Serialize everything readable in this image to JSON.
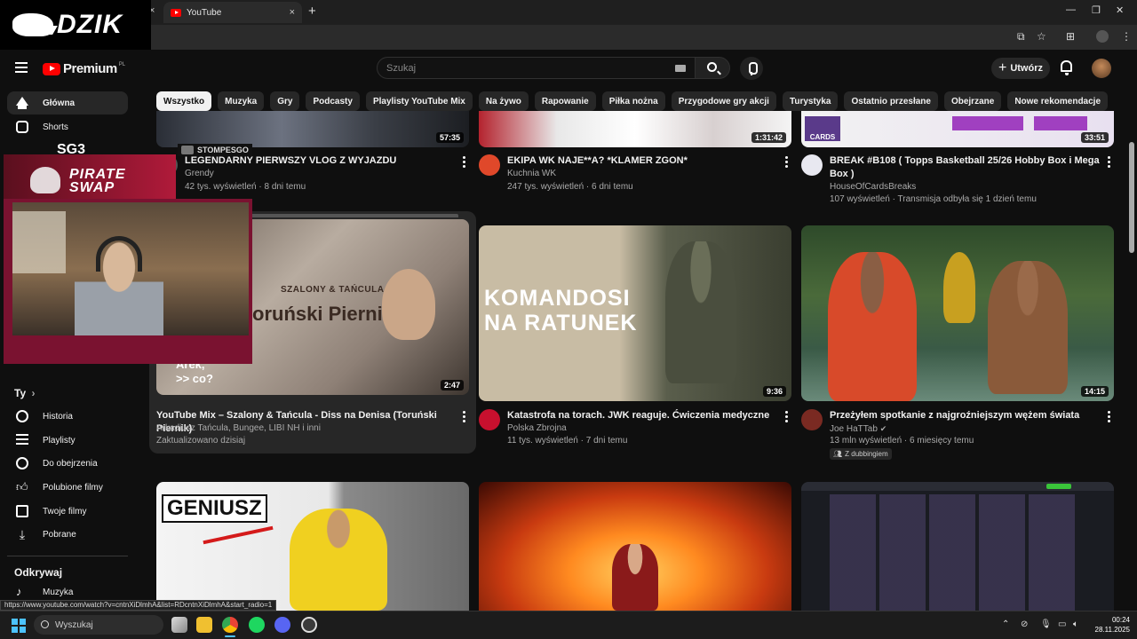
{
  "browser": {
    "tab_title": "YouTube",
    "tab_close": "×",
    "new_tab": "+",
    "status_url": "https://www.youtube.com/watch?v=cntnXiDlmhA&list=RDcntnXiDlmhA&start_radio=1"
  },
  "overlay": {
    "brand": "DZIK",
    "pirate_line1": "PIRATE",
    "pirate_line2": "SWAP",
    "cam_logo": "SG3",
    "cam_tag": "STOMPESGO"
  },
  "header": {
    "logo_text": "Premium",
    "logo_region": "PL",
    "search_placeholder": "Szukaj",
    "create_label": "Utwórz",
    "create_icon": "+"
  },
  "chips": [
    "Wszystko",
    "Muzyka",
    "Gry",
    "Podcasty",
    "Playlisty YouTube Mix",
    "Na żywo",
    "Rapowanie",
    "Piłka nożna",
    "Przygodowe gry akcji",
    "Turystyka",
    "Ostatnio przesłane",
    "Obejrzane",
    "Nowe rekomendacje"
  ],
  "sidebar": {
    "home": "Główna",
    "shorts": "Shorts",
    "you_heading": "Ty",
    "you_chevron": "›",
    "history": "Historia",
    "playlists": "Playlisty",
    "watch_later": "Do obejrzenia",
    "liked": "Polubione filmy",
    "your_videos": "Twoje filmy",
    "downloads": "Pobrane",
    "explore_heading": "Odkrywaj",
    "music": "Muzyka"
  },
  "videos": {
    "row1": [
      {
        "title": "LEGENDARNY PIERWSZY VLOG Z WYJAZDU",
        "channel": "Grendy",
        "meta": "42 tys. wyświetleń · 8 dni temu",
        "duration": "57:35"
      },
      {
        "title": "EKIPA WK NAJE**A? *KLAMER ZGON*",
        "channel": "Kuchnia WK",
        "meta": "247 tys. wyświetleń · 6 dni temu",
        "duration": "1:31:42"
      },
      {
        "title": "BREAK #B108  ( Topps Basketball 25/26 Hobby Box i Mega Box )",
        "channel": "HouseOfCardsBreaks",
        "meta": "107 wyświetleń · Transmisja odbyła się 1 dzień temu",
        "duration": "33:51",
        "thumb_text": "CARDS"
      }
    ],
    "row2": [
      {
        "title": "YouTube Mix – Szalony & Tańcula - Diss na Denisa (Toruński Piernik)",
        "channel": "Arkadiusz Tańcula, Bungee, LIBI NH i inni",
        "meta": "Zaktualizowano dzisiaj",
        "duration": "2:47",
        "thumb_text1": "SZALONY & TAŃCULA",
        "thumb_text2": "oruński Piernik",
        "thumb_text3": "Arek,",
        "thumb_text4": ">> co?"
      },
      {
        "title": "Katastrofa na torach. JWK reaguje. Ćwiczenia medyczne",
        "channel": "Polska Zbrojna",
        "meta": "11 tys. wyświetleń · 7 dni temu",
        "duration": "9:36",
        "thumb_text1": "KOMANDOSI",
        "thumb_text2": "NA RATUNEK"
      },
      {
        "title": "Przeżyłem spotkanie z najgroźniejszym wężem świata",
        "channel": "Joe HaTTab",
        "meta": "13 mln wyświetleń · 6 miesięcy temu",
        "duration": "14:15",
        "badge": "Z dubbingiem"
      }
    ],
    "row3": [
      {
        "thumb_text": "GENIUSZ"
      }
    ]
  },
  "taskbar": {
    "search": "Wyszukaj",
    "time": "00:24",
    "date": "28.11.2025"
  },
  "colors": {
    "accent_red": "#ff0000",
    "bg": "#0f0f0f",
    "chip": "#272727",
    "stream_overlay": "#7a1230"
  }
}
